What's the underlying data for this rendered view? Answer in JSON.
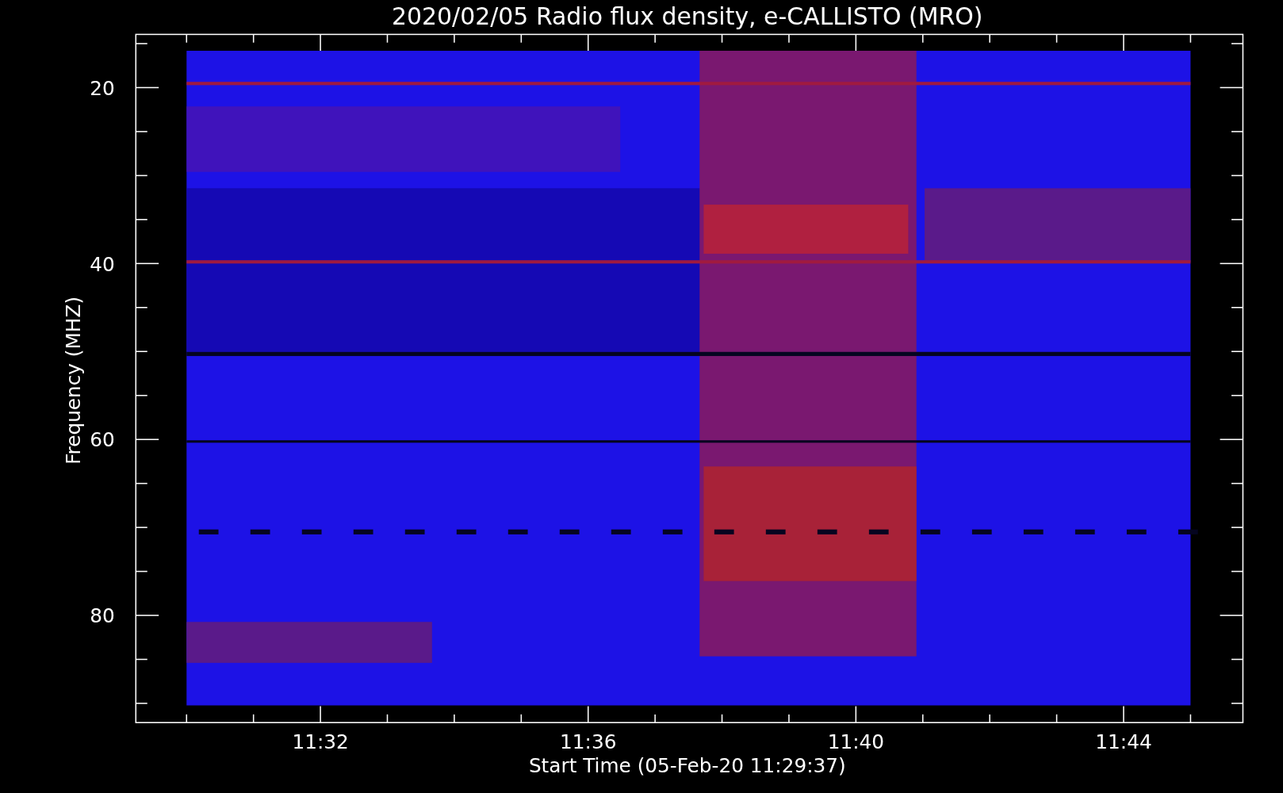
{
  "plot": {
    "title": "2020/02/05  Radio flux density, e-CALLISTO (MRO)",
    "x_axis": {
      "label": "Start Time (05-Feb-20 11:29:37)",
      "ticks": [
        "11:32",
        "11:36",
        "11:40",
        "11:44"
      ]
    },
    "y_axis": {
      "label": "Frequency (MHZ)",
      "ticks": [
        "20",
        "40",
        "60",
        "80"
      ]
    }
  }
}
